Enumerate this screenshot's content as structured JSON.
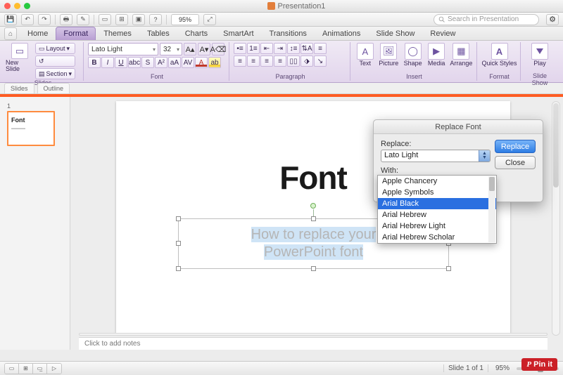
{
  "window": {
    "title": "Presentation1"
  },
  "qat": {
    "zoom": "95%",
    "search_placeholder": "Search in Presentation"
  },
  "tabs": [
    "Home",
    "Format",
    "Themes",
    "Tables",
    "Charts",
    "SmartArt",
    "Transitions",
    "Animations",
    "Slide Show",
    "Review"
  ],
  "active_tab": "Format",
  "ribbon": {
    "groups": [
      "Slides",
      "Font",
      "Paragraph",
      "Insert",
      "Format",
      "Slide Show"
    ],
    "slides": {
      "new_slide": "New Slide",
      "layout": "Layout",
      "section": "Section"
    },
    "font": {
      "name": "Lato Light",
      "size": "32"
    },
    "insert": {
      "text": "Text",
      "picture": "Picture",
      "shape": "Shape",
      "media": "Media",
      "arrange": "Arrange"
    },
    "format": {
      "quick_styles": "Quick Styles"
    },
    "slideshow": {
      "play": "Play"
    }
  },
  "side_tabs": [
    "Slides",
    "Outline"
  ],
  "thumbnail": {
    "num": "1",
    "title": "Font"
  },
  "slide": {
    "title": "Font",
    "subtitle_line1": "How to replace your",
    "subtitle_line2": "PowerPoint font"
  },
  "notes_placeholder": "Click to add notes",
  "status": {
    "slide_pos": "Slide 1 of 1",
    "zoom": "95%"
  },
  "dialog": {
    "title": "Replace Font",
    "replace_label": "Replace:",
    "replace_value": "Lato Light",
    "with_label": "With:",
    "with_value": "Arial Black",
    "btn_replace": "Replace",
    "btn_close": "Close",
    "options": [
      "Apple Chancery",
      "Apple Symbols",
      "Arial Black",
      "Arial Hebrew",
      "Arial Hebrew Light",
      "Arial Hebrew Scholar"
    ],
    "selected_option": "Arial Black"
  },
  "pinit": "Pin it"
}
